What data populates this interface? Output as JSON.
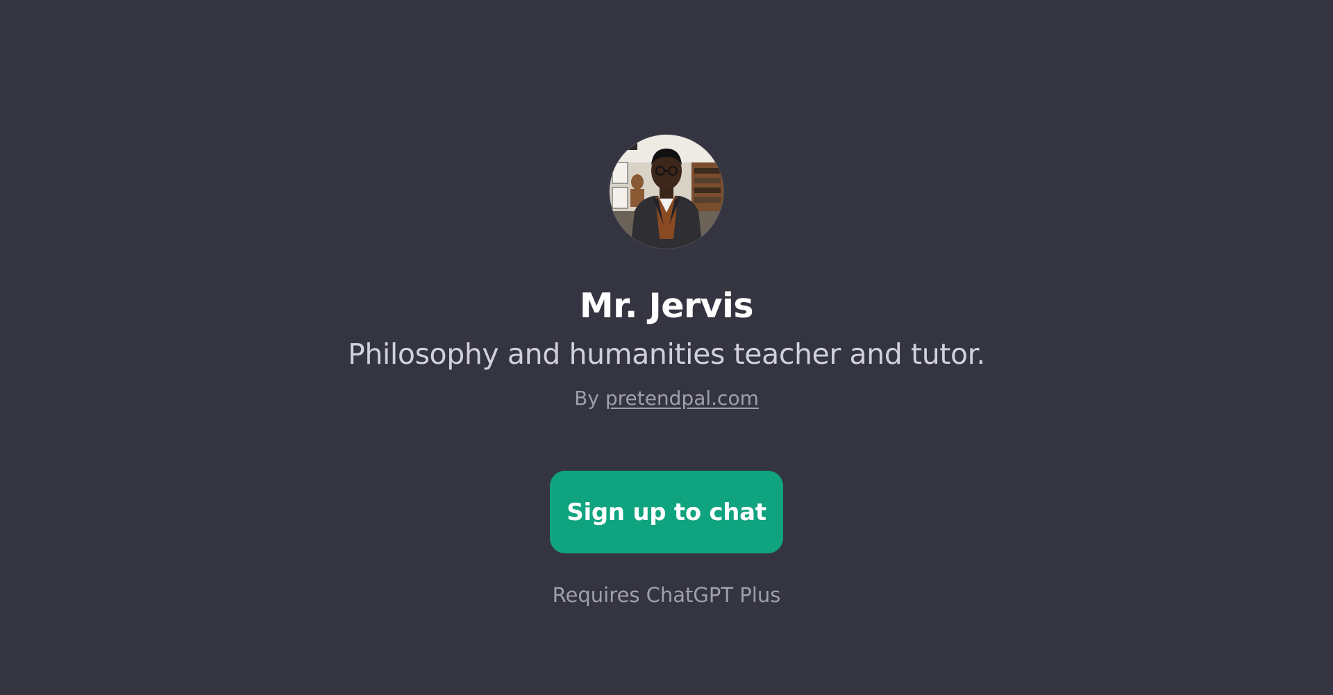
{
  "gpt": {
    "name": "Mr. Jervis",
    "description": "Philosophy and humanities teacher and tutor.",
    "by_prefix": "By",
    "author_link": "pretendpal.com",
    "avatar_icon": "avatar-portrait"
  },
  "cta": {
    "label": "Sign up to chat",
    "color": "#10a37f"
  },
  "footer": {
    "requires_text": "Requires ChatGPT Plus"
  },
  "theme": {
    "background": "#343541",
    "title_color": "#ffffff",
    "muted_color": "#a0a0ab"
  }
}
